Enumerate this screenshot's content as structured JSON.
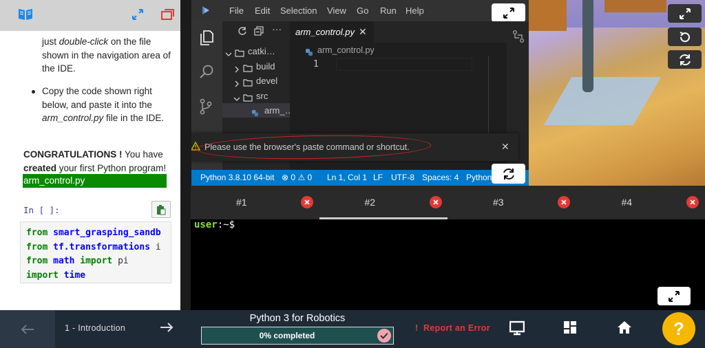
{
  "notebook": {
    "para1_pre": "just ",
    "para1_em": "double-click",
    "para1_post": " on the file shown in the navigation area of the IDE.",
    "bullet2_pre": "Copy the code shown right below, and paste it into the ",
    "bullet2_em": "arm_control.py",
    "bullet2_post": " file in the IDE.",
    "congrats_bold": "CONGRATULATIONS !",
    "congrats_mid": " You have ",
    "congrats_bold2": "created",
    "congrats_post": " your first Python program!",
    "file_label": "arm_control.py",
    "cell_prompt": "In [ ]:",
    "code_lines": [
      {
        "kw": "from",
        "name": "smart_grasping_sandb",
        "rest": ""
      },
      {
        "kw": "from",
        "name": "tf.transformations",
        "rest": " i"
      },
      {
        "kw": "from",
        "name": "math",
        "rest": " import pi",
        "kw2": "import"
      },
      {
        "kw": "import",
        "name": "time",
        "rest": ""
      }
    ]
  },
  "ide": {
    "menu": [
      "File",
      "Edit",
      "Selection",
      "View",
      "Go",
      "Run",
      "Help"
    ],
    "tree": [
      {
        "label": "catki…",
        "kind": "folder-open",
        "indent": 0
      },
      {
        "label": "build",
        "kind": "folder",
        "indent": 1
      },
      {
        "label": "devel",
        "kind": "folder",
        "indent": 1
      },
      {
        "label": "src",
        "kind": "folder-open",
        "indent": 1
      },
      {
        "label": "arm_…",
        "kind": "file",
        "indent": 2
      }
    ],
    "tab_label": "arm_control.py",
    "tab_close": "✕",
    "breadcrumb": "arm_control.py",
    "line_number": "1",
    "notification": "Please use the browser's paste command or shortcut.",
    "notification_close": "✕",
    "status": {
      "python": "Python 3.8.10 64-bit",
      "errors": "0",
      "warnings": "0",
      "position": "Ln 1, Col 1",
      "eol": "LF",
      "encoding": "UTF-8",
      "spaces": "Spaces: 4",
      "language": "Python"
    }
  },
  "terminal": {
    "tabs": [
      "#1",
      "#2",
      "#3",
      "#4"
    ],
    "active_tab": 1,
    "prompt_user": "user",
    "prompt_rest": ":~$"
  },
  "bottom": {
    "chapter": "1 - Introduction",
    "course": "Python 3 for Robotics",
    "progress_text": "0% completed",
    "progress": 0,
    "report": "Report an Error",
    "help": "?"
  },
  "colors": {
    "accent_blue": "#007acc",
    "notebook_blue": "#1e88e5",
    "green_file": "#0a8a00",
    "danger": "#e53935",
    "help_yellow": "#f5b700"
  }
}
